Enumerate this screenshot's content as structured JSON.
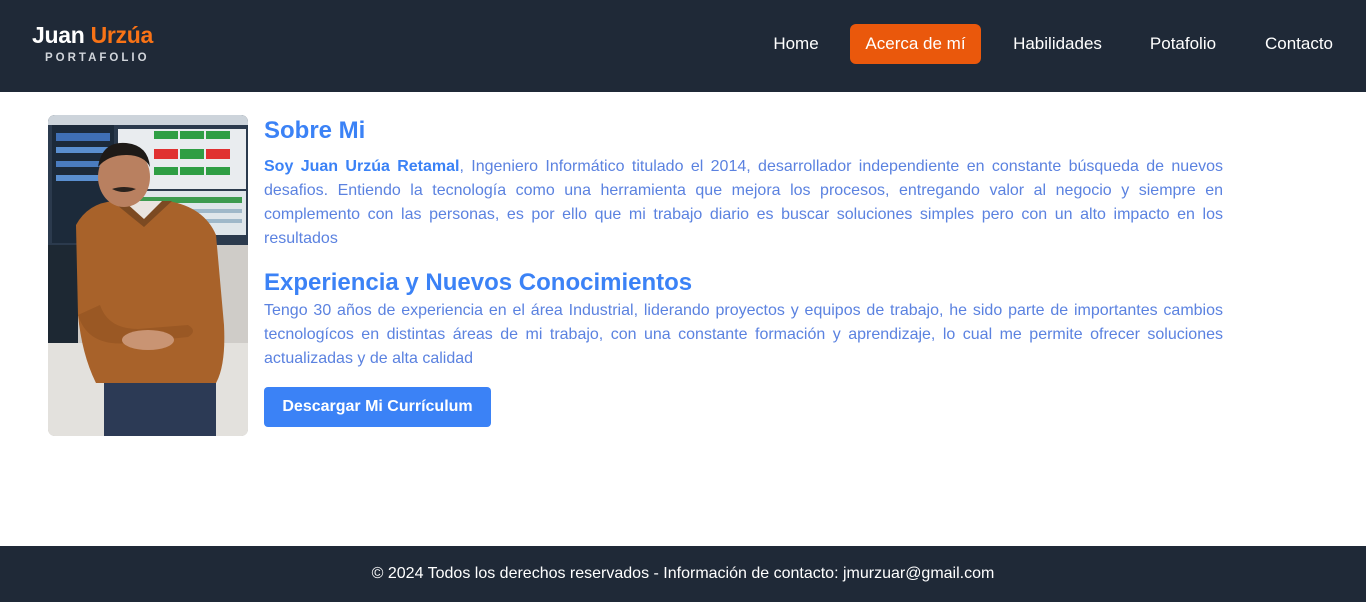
{
  "brand": {
    "first_name": "Juan",
    "last_name": "Urzúa",
    "subtitle": "PORTAFOLIO"
  },
  "nav": {
    "items": [
      {
        "label": "Home",
        "active": false
      },
      {
        "label": "Acerca de mí",
        "active": true
      },
      {
        "label": "Habilidades",
        "active": false
      },
      {
        "label": "Potafolio",
        "active": false
      },
      {
        "label": "Contacto",
        "active": false
      }
    ]
  },
  "about": {
    "title": "Sobre Mi",
    "intro_bold": "Soy Juan Urzúa Retamal",
    "intro_rest": ", Ingeniero Informático titulado el 2014, desarrollador independiente en constante búsqueda de nuevos desafios. Entiendo la tecnología como una herramienta que mejora los procesos, entregando valor al negocio y siempre en complemento con las personas, es por ello que mi trabajo diario es buscar soluciones simples pero con un alto impacto en los resultados"
  },
  "experience": {
    "title": "Experiencia y Nuevos Conocimientos",
    "text": "Tengo 30 años de experiencia en el área Industrial, liderando proyectos y equipos de trabajo, he sido parte de importantes cambios tecnologícos en distintas áreas de mi trabajo, con una constante formación y aprendizaje, lo cual me permite ofrecer soluciones actualizadas y de alta calidad"
  },
  "cv_button": {
    "label": "Descargar Mi Currículum"
  },
  "footer": {
    "text": "© 2024 Todos los derechos reservados - Información de contacto: jmurzuar@gmail.com"
  },
  "colors": {
    "header_bg": "#1f2937",
    "accent_orange": "#ea580c",
    "brand_orange": "#f97316",
    "heading_blue": "#3b82f6",
    "text_blue": "#5b82e0"
  }
}
